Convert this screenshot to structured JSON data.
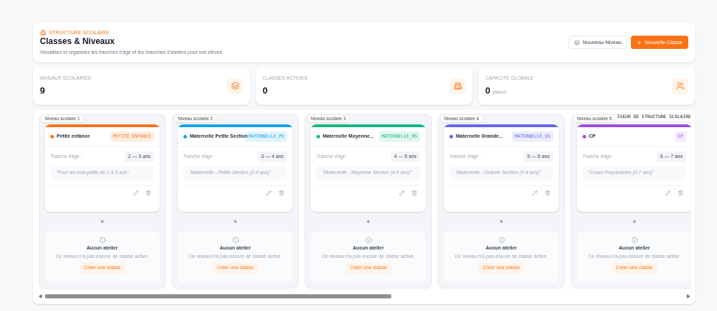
{
  "header": {
    "eyebrow": "STRUCTURE SCOLAIRE",
    "title": "Classes & Niveaux",
    "subtitle": "Visualisez et organisez les tranches d'âge et les branches d'ateliers pour vos élèves.",
    "buttons": [
      {
        "label": "Nouveau Niveau",
        "kind": "secondary"
      },
      {
        "label": "Nouvelle Classe",
        "kind": "primary"
      }
    ]
  },
  "stats": [
    {
      "label": "NIVEAUX SCOLAIRES",
      "value": "9"
    },
    {
      "label": "CLASSES ACTIVES",
      "value": "0"
    },
    {
      "label": "CAPACITÉ GLOBALE",
      "value": "0",
      "unit": "places"
    }
  ],
  "board": {
    "overlay_text": "ISEUR DE STRUCTURE SCOLAIRE",
    "levels": [
      {
        "label": "Niveau scolaire 1",
        "name": "Petite enfance",
        "code": "PETITE_ENFANCE",
        "color": "#f97316",
        "age_label": "Tranche d'âge :",
        "age": "2 — 3 ans",
        "description": "\"Pour les tout-petits de 2 à 3 ans\"",
        "empty_title": "Aucun atelier",
        "empty_text": "Ce niveau n'a pas encore de classe active.",
        "action": "Créer une classe"
      },
      {
        "label": "Niveau scolaire 2",
        "name": "Maternelle Petite Section",
        "code": "MATERNELLE_PS",
        "color": "#0ea5e9",
        "age_label": "Tranche d'âge :",
        "age": "3 — 4 ans",
        "description": "\"Maternelle - Petite Section (3-4 ans)\"",
        "empty_title": "Aucun atelier",
        "empty_text": "Ce niveau n'a pas encore de classe active.",
        "action": "Créer une classe"
      },
      {
        "label": "Niveau scolaire 3",
        "name": "Maternelle Moyenne...",
        "code": "MATERNELLE_MS",
        "color": "#10b981",
        "age_label": "Tranche d'âge :",
        "age": "4 — 5 ans",
        "description": "\"Maternelle - Moyenne Section (4-5 ans)\"",
        "empty_title": "Aucun atelier",
        "empty_text": "Ce niveau n'a pas encore de classe active.",
        "action": "Créer une classe"
      },
      {
        "label": "Niveau scolaire 4",
        "name": "Maternelle Grande...",
        "code": "MATERNELLE_GS",
        "color": "#6366f1",
        "age_label": "Tranche d'âge :",
        "age": "5 — 6 ans",
        "description": "\"Maternelle - Grande Section (5-6 ans)\"",
        "empty_title": "Aucun atelier",
        "empty_text": "Ce niveau n'a pas encore de classe active.",
        "action": "Créer une classe"
      },
      {
        "label": "Niveau scolaire 5",
        "name": "CP",
        "code": "CP",
        "color": "#9b4de0",
        "age_label": "Tranche d'âge :",
        "age": "6 — 7 ans",
        "description": "\"Cours Préparatoire (6-7 ans)\"",
        "empty_title": "Aucun atelier",
        "empty_text": "Ce niveau n'a pas encore de classe active.",
        "action": "Créer une classe"
      }
    ]
  }
}
